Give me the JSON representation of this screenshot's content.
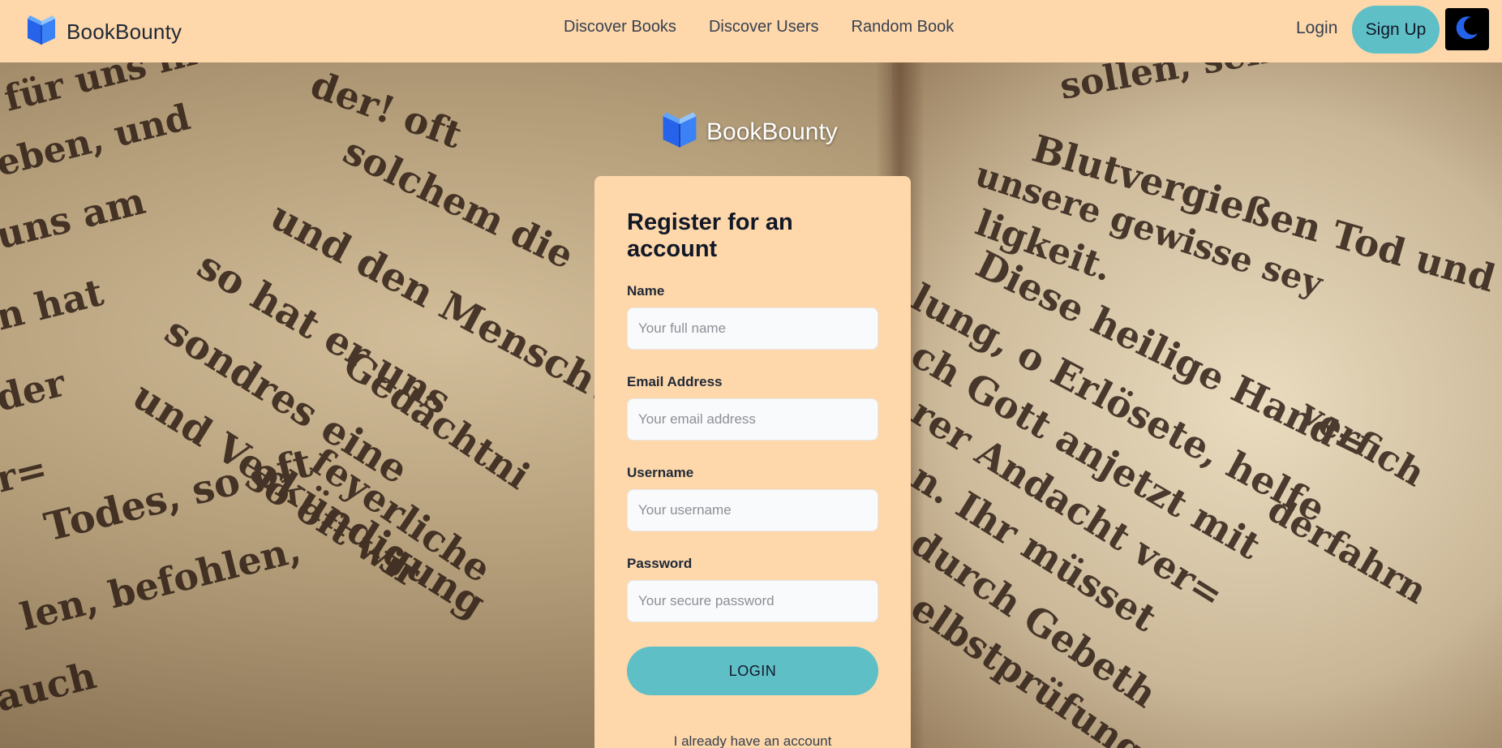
{
  "navbar": {
    "brand": "BookBounty",
    "links": [
      {
        "label": "Discover Books"
      },
      {
        "label": "Discover Users"
      },
      {
        "label": "Random Book"
      }
    ],
    "login_label": "Login",
    "signup_label": "Sign Up",
    "theme_icon": "moon-icon"
  },
  "hero": {
    "brand": "BookBounty",
    "background": "old blackletter book pages"
  },
  "form": {
    "title": "Register for an account",
    "fields": [
      {
        "label": "Name",
        "placeholder": "Your full name",
        "value": ""
      },
      {
        "label": "Email Address",
        "placeholder": "Your email address",
        "value": ""
      },
      {
        "label": "Username",
        "placeholder": "Your username",
        "value": ""
      },
      {
        "label": "Password",
        "placeholder": "Your secure password",
        "value": ""
      }
    ],
    "submit_label": "LOGIN",
    "alt_link": "I already have an account"
  },
  "colors": {
    "navbar_bg": "#fed7aa",
    "card_bg": "#fed7aa",
    "accent": "#5fbfc7",
    "logo_blue": "#2563eb"
  }
}
